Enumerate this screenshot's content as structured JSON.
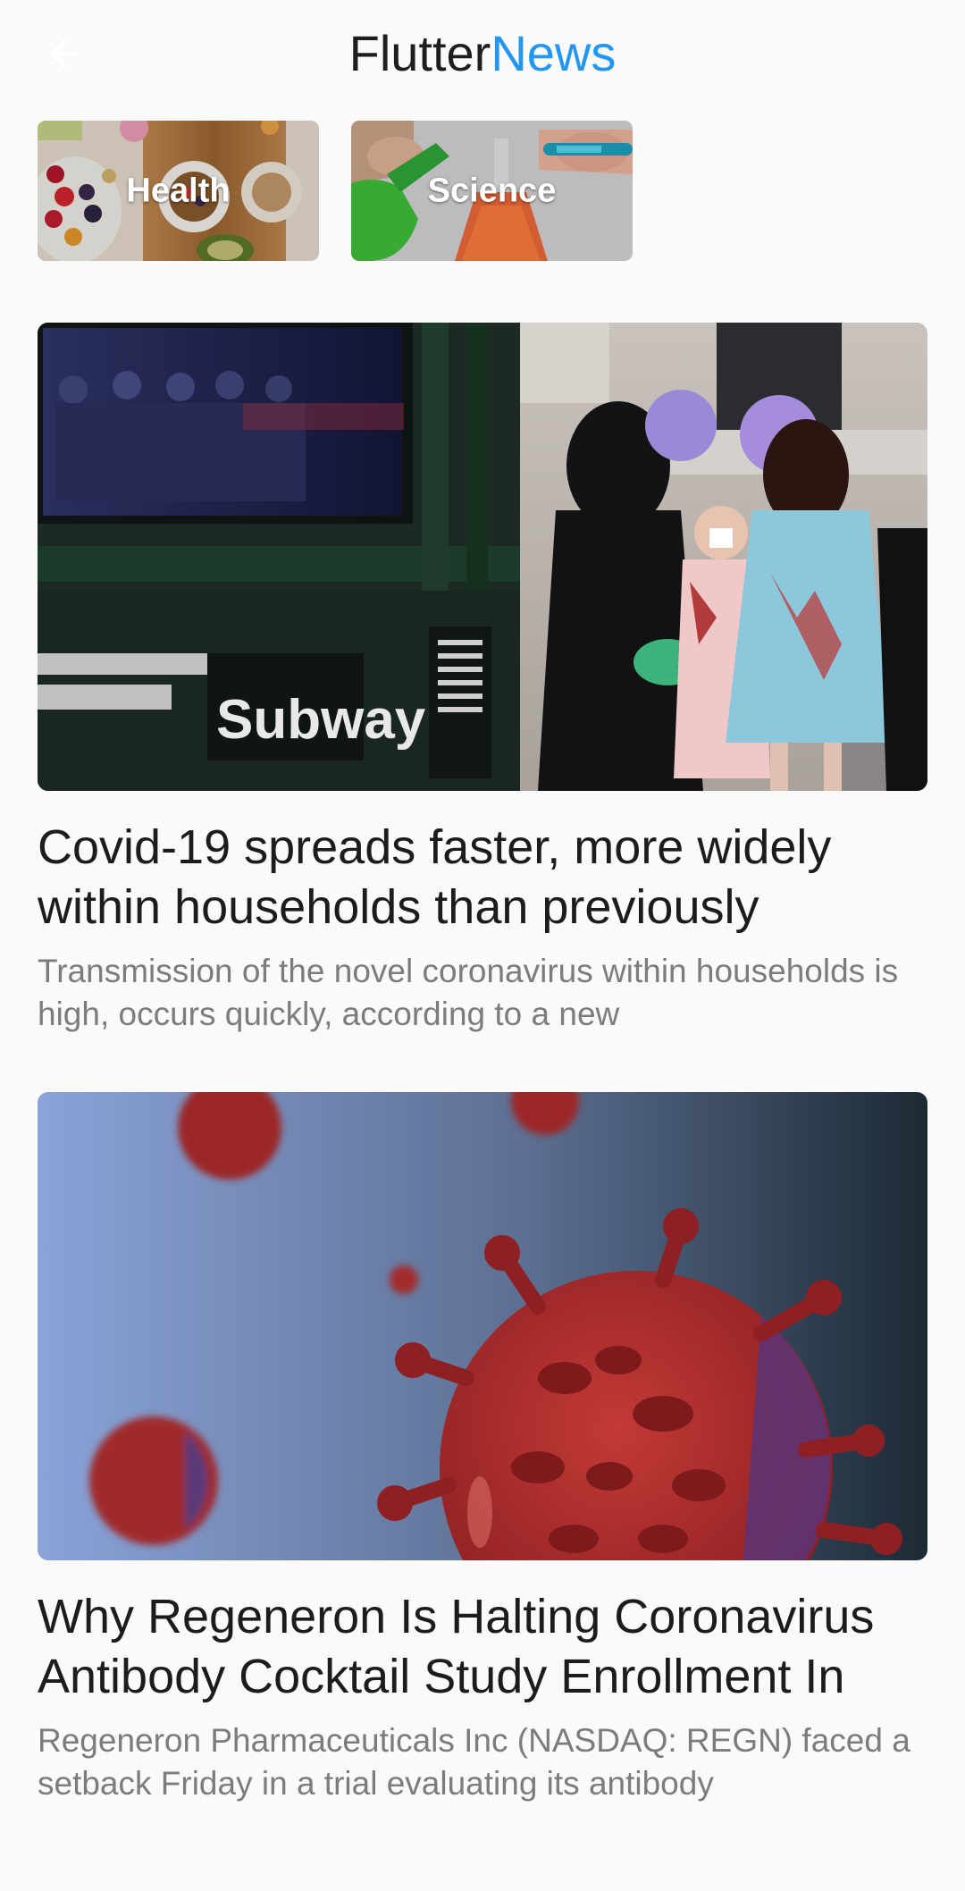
{
  "appbar": {
    "back_icon": "arrow-back-icon",
    "brand_part1": "Flutter",
    "brand_part2": "News",
    "brand_accent": "#2196f3"
  },
  "categories": [
    {
      "label": "Health"
    },
    {
      "label": "Science"
    }
  ],
  "articles": [
    {
      "title": "Covid-19 spreads faster, more widely within households than previously",
      "description": "Transmission of the novel coronavirus within households is high, occurs quickly, according to a new",
      "image_text": "Subway"
    },
    {
      "title": "Why Regeneron Is Halting Coronavirus Antibody Cocktail Study Enrollment In",
      "description": "Regeneron Pharmaceuticals Inc (NASDAQ: REGN) faced a setback Friday in a trial evaluating its antibody"
    }
  ]
}
